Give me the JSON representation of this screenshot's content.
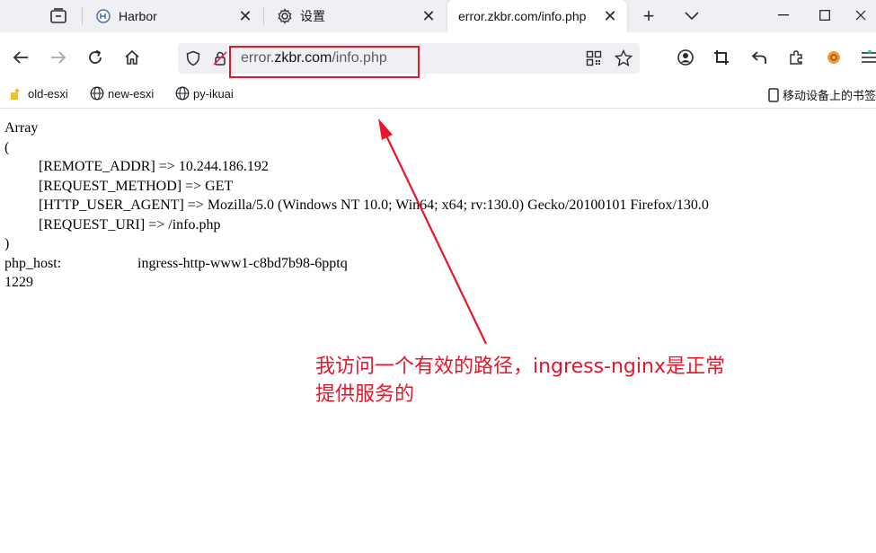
{
  "tabs": [
    {
      "title": "Harbor",
      "icon": "harbor-logo-icon",
      "active": false
    },
    {
      "title": "设置",
      "icon": "gear-icon",
      "active": false
    },
    {
      "title": "error.zkbr.com/info.php",
      "icon": "",
      "active": true
    }
  ],
  "url": {
    "prefix": "error.",
    "host": "zkbr.com",
    "path": "/info.php"
  },
  "bookmarks": [
    {
      "label": "old-esxi",
      "icon": "folder-icon"
    },
    {
      "label": "new-esxi",
      "icon": "globe-icon"
    },
    {
      "label": "py-ikuai",
      "icon": "globe-icon"
    }
  ],
  "mobile_bookmarks": "移动设备上的书签",
  "page": {
    "array_open": "Array",
    "paren_open": "(",
    "rows": [
      "[REMOTE_ADDR] => 10.244.186.192",
      "[REQUEST_METHOD] => GET",
      "[HTTP_USER_AGENT] => Mozilla/5.0 (Windows NT 10.0; Win64; x64; rv:130.0) Gecko/20100101 Firefox/130.0",
      "[REQUEST_URI] => /info.php"
    ],
    "paren_close": ")",
    "host_key": "php_host:",
    "host_value": "ingress-http-www1-c8bd7b98-6pptq",
    "counter": "1229"
  },
  "annotation": {
    "line1": "我访问一个有效的路径，ingress-nginx是正常",
    "line2": "提供服务的",
    "color": "#e8162a"
  }
}
